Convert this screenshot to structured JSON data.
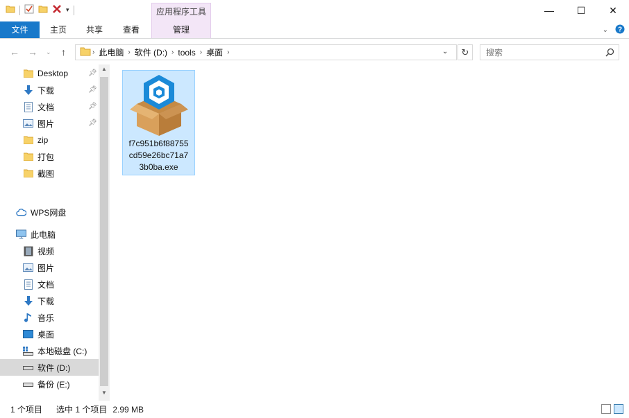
{
  "title_bar": {
    "context_tab_header": "应用程序工具",
    "window_controls": {
      "minimize": "—",
      "maximize": "☐",
      "close": "✕"
    }
  },
  "ribbon": {
    "tabs": [
      {
        "label": "文件"
      },
      {
        "label": "主页"
      },
      {
        "label": "共享"
      },
      {
        "label": "查看"
      },
      {
        "label": "管理"
      }
    ]
  },
  "address_bar": {
    "breadcrumbs": [
      "此电脑",
      "软件 (D:)",
      "tools",
      "桌面"
    ],
    "search_placeholder": "搜索"
  },
  "nav_pane": {
    "quick_access": [
      {
        "label": "Desktop",
        "icon": "folder-icon",
        "pinned": true
      },
      {
        "label": "下载",
        "icon": "download-arrow-icon",
        "pinned": true
      },
      {
        "label": "文档",
        "icon": "document-icon",
        "pinned": true
      },
      {
        "label": "图片",
        "icon": "picture-icon",
        "pinned": true
      },
      {
        "label": "zip",
        "icon": "folder-icon",
        "pinned": false
      },
      {
        "label": "打包",
        "icon": "folder-icon",
        "pinned": false
      },
      {
        "label": "截图",
        "icon": "folder-icon",
        "pinned": false
      }
    ],
    "wps": {
      "label": "WPS网盘",
      "icon": "cloud-icon"
    },
    "this_pc": {
      "label": "此电脑",
      "icon": "computer-icon"
    },
    "pc_items": [
      {
        "label": "视频",
        "icon": "video-icon"
      },
      {
        "label": "图片",
        "icon": "picture-icon"
      },
      {
        "label": "文档",
        "icon": "document-icon"
      },
      {
        "label": "下载",
        "icon": "download-arrow-icon"
      },
      {
        "label": "音乐",
        "icon": "music-icon"
      },
      {
        "label": "桌面",
        "icon": "desktop-icon"
      },
      {
        "label": "本地磁盘 (C:)",
        "icon": "system-drive-icon"
      },
      {
        "label": "软件 (D:)",
        "icon": "drive-icon",
        "selected": true
      },
      {
        "label": "备份 (E:)",
        "icon": "drive-icon"
      }
    ]
  },
  "content": {
    "files": [
      {
        "name": "f7c951b6f88755cd59e26bc71a73b0ba.exe",
        "name_lines": [
          "f7c951b6f88755",
          "cd59e26bc71a7",
          "3b0ba.exe"
        ],
        "icon": "installer-box-icon",
        "selected": true
      }
    ]
  },
  "status_bar": {
    "item_count": "1 个项目",
    "selected": "选中 1 个项目",
    "size": "2.99 MB"
  },
  "colors": {
    "file_tab_bg": "#1979ca",
    "context_tab_bg": "#f3e6f7",
    "selection_bg": "#cce8ff",
    "selection_border": "#99d1ff",
    "help_icon": "#1979ca"
  }
}
